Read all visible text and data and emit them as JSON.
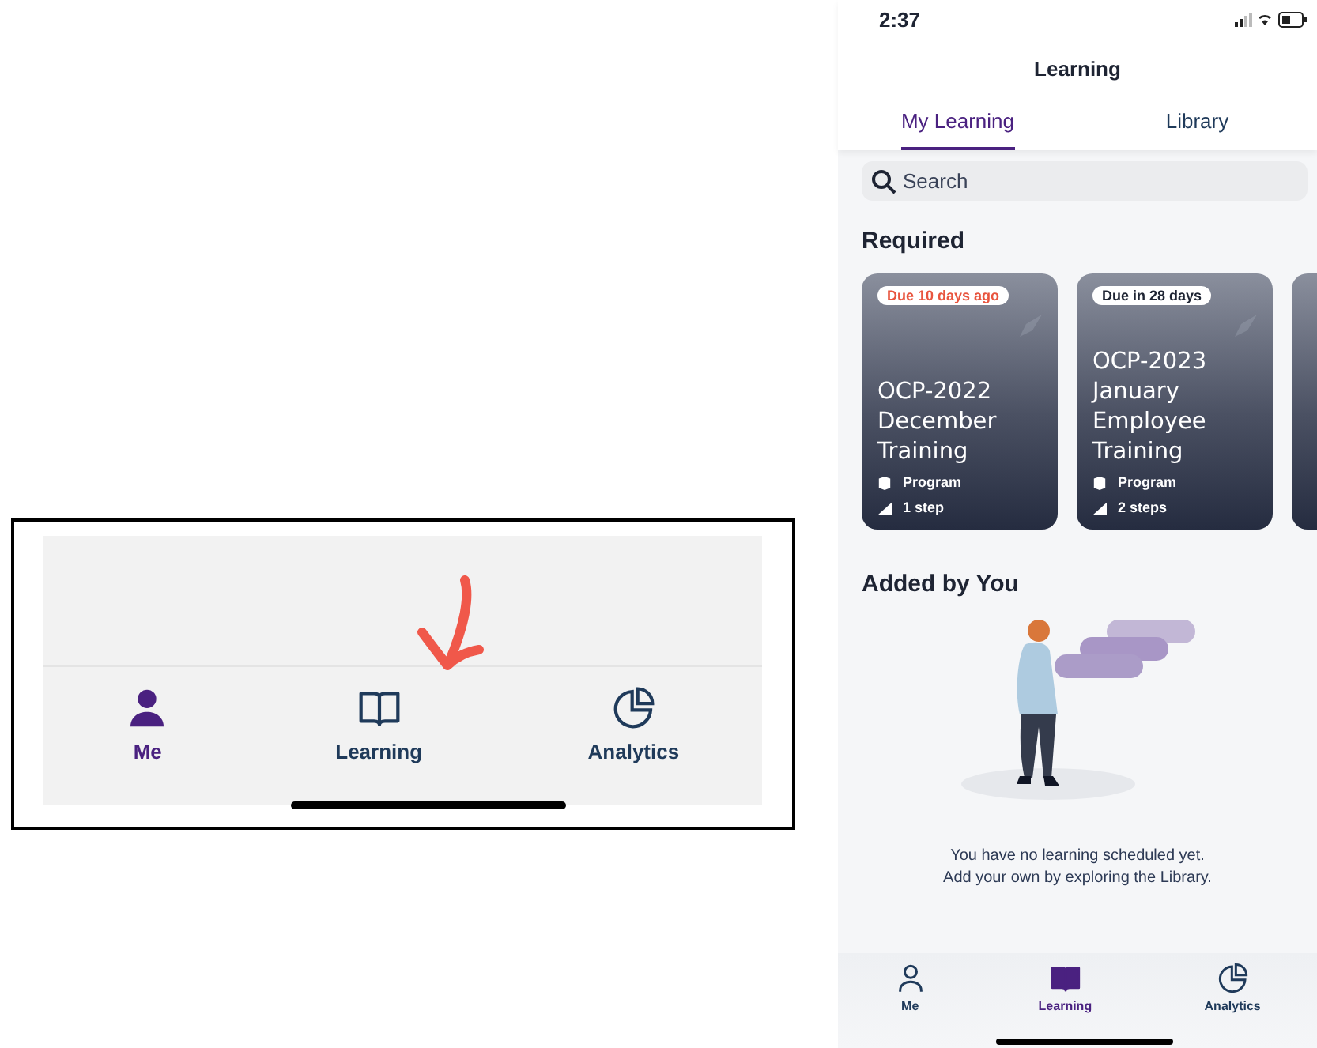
{
  "annotated_tab_bar": {
    "nav_items": [
      {
        "label": "Me",
        "selected": true
      },
      {
        "label": "Learning",
        "selected": false
      },
      {
        "label": "Analytics",
        "selected": false
      }
    ]
  },
  "phone": {
    "status_bar": {
      "time": "2:37"
    },
    "title": "Learning",
    "tabs": [
      {
        "label": "My Learning",
        "selected": true
      },
      {
        "label": "Library",
        "selected": false
      }
    ],
    "search": {
      "placeholder": "Search"
    },
    "required": {
      "heading": "Required",
      "cards": [
        {
          "due": "Due 10 days ago",
          "overdue": true,
          "title": "OCP-2022 December Training",
          "type": "Program",
          "steps": "1 step"
        },
        {
          "due": "Due in 28 days",
          "overdue": false,
          "title": "OCP-2023 January Employee Training",
          "type": "Program",
          "steps": "2 steps"
        }
      ]
    },
    "added_by_you": {
      "heading": "Added by You",
      "empty_message": [
        "You have no learning scheduled yet.",
        "Add your own by exploring the Library."
      ]
    },
    "nav_items": [
      {
        "label": "Me",
        "selected": false
      },
      {
        "label": "Learning",
        "selected": true
      },
      {
        "label": "Analytics",
        "selected": false
      }
    ]
  }
}
